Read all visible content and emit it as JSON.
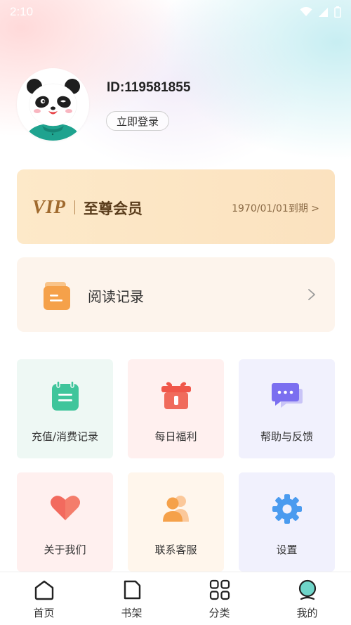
{
  "status_bar": {
    "time": "2:10"
  },
  "profile": {
    "user_id": "ID:119581855",
    "login_label": "立即登录"
  },
  "vip": {
    "logo_text": "VIP",
    "title": "至尊会员",
    "expire_text": "1970/01/01到期 >"
  },
  "reading_record": {
    "label": "阅读记录",
    "arrow": ">"
  },
  "grid": {
    "items": [
      {
        "label": "充值/消费记录",
        "icon": "calendar-icon",
        "bg": "#eef8f4"
      },
      {
        "label": "每日福利",
        "icon": "gift-icon",
        "bg": "#fff0ef"
      },
      {
        "label": "帮助与反馈",
        "icon": "chat-icon",
        "bg": "#f1f1fd"
      },
      {
        "label": "关于我们",
        "icon": "heart-icon",
        "bg": "#fff0ef"
      },
      {
        "label": "联系客服",
        "icon": "users-icon",
        "bg": "#fff6ec"
      },
      {
        "label": "设置",
        "icon": "gear-icon",
        "bg": "#f1f1fd"
      }
    ]
  },
  "bottom_nav": {
    "items": [
      {
        "label": "首页",
        "icon": "home-icon"
      },
      {
        "label": "书架",
        "icon": "bookshelf-icon"
      },
      {
        "label": "分类",
        "icon": "category-icon"
      },
      {
        "label": "我的",
        "icon": "profile-icon"
      }
    ]
  },
  "colors": {
    "accent_gold": "#a06a2e",
    "green": "#3fc59b",
    "red": "#f0574a",
    "purple": "#7b6ff0",
    "orange": "#f5a14a",
    "blue": "#4a9bef",
    "teal": "#6fd5c9"
  }
}
